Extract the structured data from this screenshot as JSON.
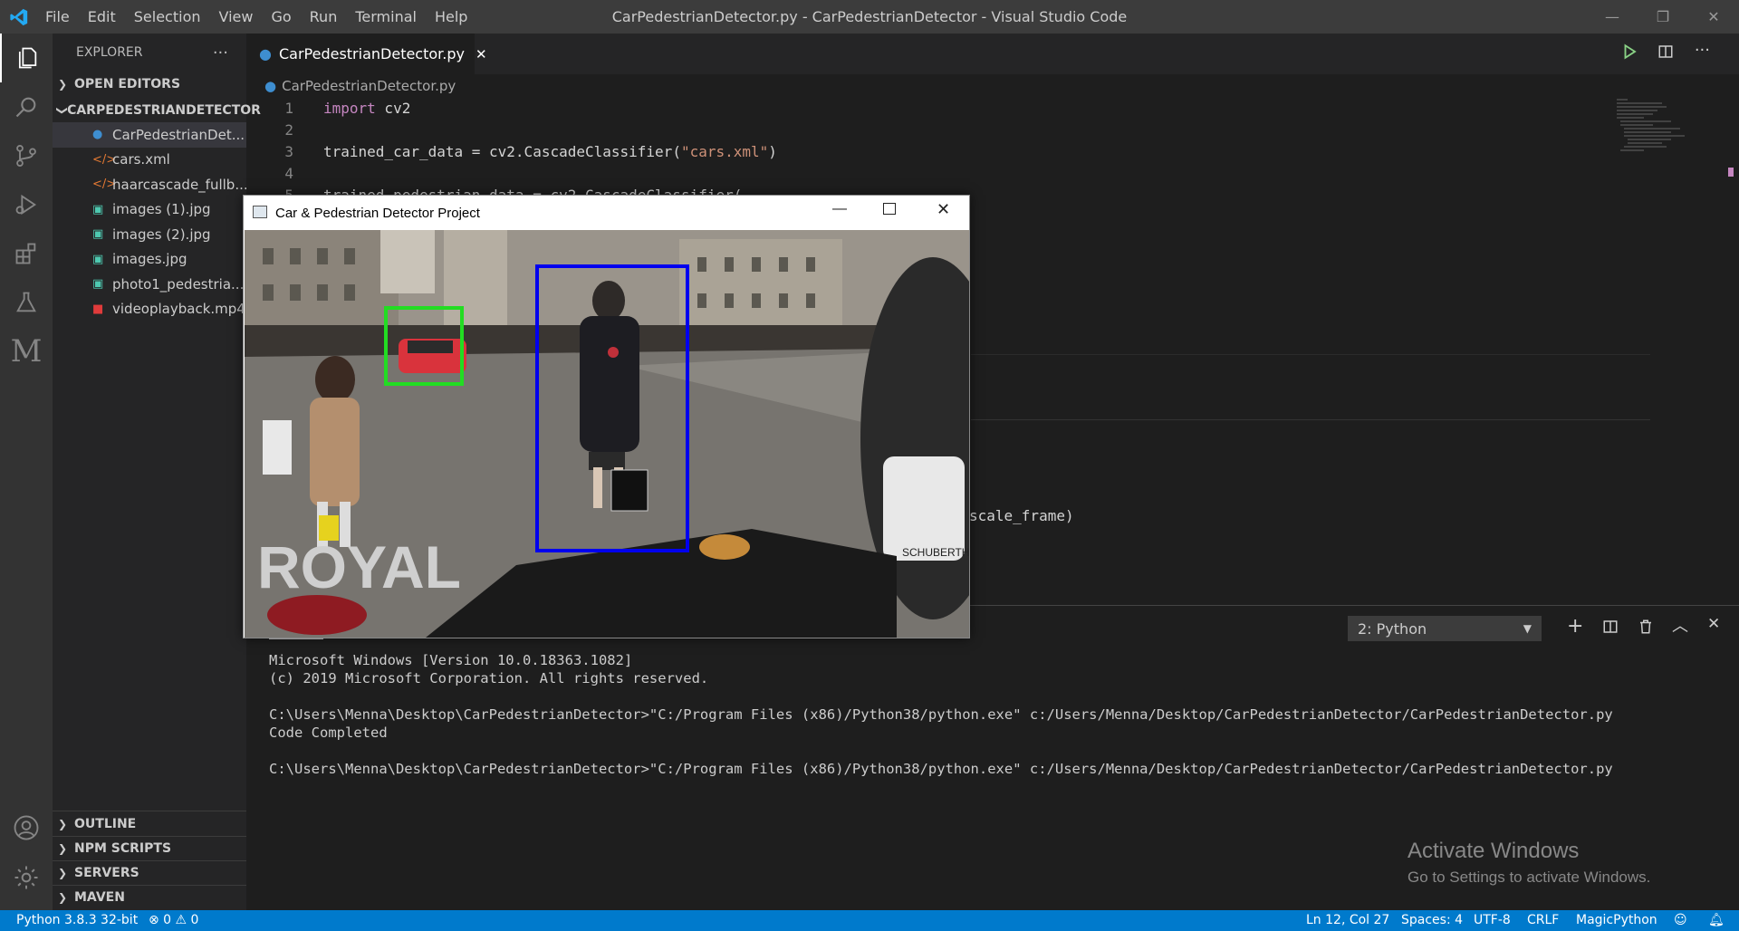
{
  "titlebar": {
    "menu": [
      "File",
      "Edit",
      "Selection",
      "View",
      "Go",
      "Run",
      "Terminal",
      "Help"
    ],
    "title": "CarPedestrianDetector.py - CarPedestrianDetector - Visual Studio Code"
  },
  "sidebar": {
    "header": "EXPLORER",
    "more": "···",
    "open_editors": "OPEN EDITORS",
    "project": "CARPEDESTRIANDETECTOR",
    "files": [
      {
        "name": "CarPedestrianDet...",
        "icon": "python-icon"
      },
      {
        "name": "cars.xml",
        "icon": "xml-icon"
      },
      {
        "name": "haarcascade_fullb...",
        "icon": "xml-icon"
      },
      {
        "name": "images (1).jpg",
        "icon": "image-icon"
      },
      {
        "name": "images (2).jpg",
        "icon": "image-icon"
      },
      {
        "name": "images.jpg",
        "icon": "image-icon"
      },
      {
        "name": "photo1_pedestria...",
        "icon": "image-icon"
      },
      {
        "name": "videoplayback.mp4",
        "icon": "video-icon"
      }
    ],
    "bottom_sections": [
      "OUTLINE",
      "NPM SCRIPTS",
      "SERVERS",
      "MAVEN"
    ]
  },
  "editor": {
    "tab": "CarPedestrianDetector.py",
    "breadcrumb": "CarPedestrianDetector.py",
    "lines": [
      {
        "n": "1",
        "kw": "import",
        "rest": " cv2"
      },
      {
        "n": "2",
        "text": ""
      },
      {
        "n": "3",
        "pre": "trained_car_data = cv2.CascadeClassifier(",
        "str": "\"cars.xml\"",
        "post": ")"
      },
      {
        "n": "4",
        "text": ""
      },
      {
        "n": "5",
        "text": "trained_pedestrian_data = cv2.CascadeClassifier("
      }
    ],
    "partial_line": "scale_frame)"
  },
  "popup": {
    "title": "Car & Pedestrian Detector Project",
    "watermark": "ROYAL",
    "bike_label": "SCHUBERTH"
  },
  "panel": {
    "selector": "2: Python",
    "terminal_lines": [
      "Microsoft Windows [Version 10.0.18363.1082]",
      "(c) 2019 Microsoft Corporation. All rights reserved.",
      "",
      "C:\\Users\\Menna\\Desktop\\CarPedestrianDetector>\"C:/Program Files (x86)/Python38/python.exe\" c:/Users/Menna/Desktop/CarPedestrianDetector/CarPedestrianDetector.py",
      "Code Completed",
      "",
      "C:\\Users\\Menna\\Desktop\\CarPedestrianDetector>\"C:/Program Files (x86)/Python38/python.exe\" c:/Users/Menna/Desktop/CarPedestrianDetector/CarPedestrianDetector.py"
    ],
    "activate_title": "Activate Windows",
    "activate_sub": "Go to Settings to activate Windows."
  },
  "statusbar": {
    "python": "Python 3.8.3 32-bit",
    "errors": "⊗ 0 ⚠ 0",
    "position": "Ln 12, Col 27",
    "spaces": "Spaces: 4",
    "encoding": "UTF-8",
    "eol": "CRLF",
    "language": "MagicPython"
  },
  "colors": {
    "accent": "#007acc",
    "car_box": "#22dd22",
    "person_box": "#0000ee"
  }
}
